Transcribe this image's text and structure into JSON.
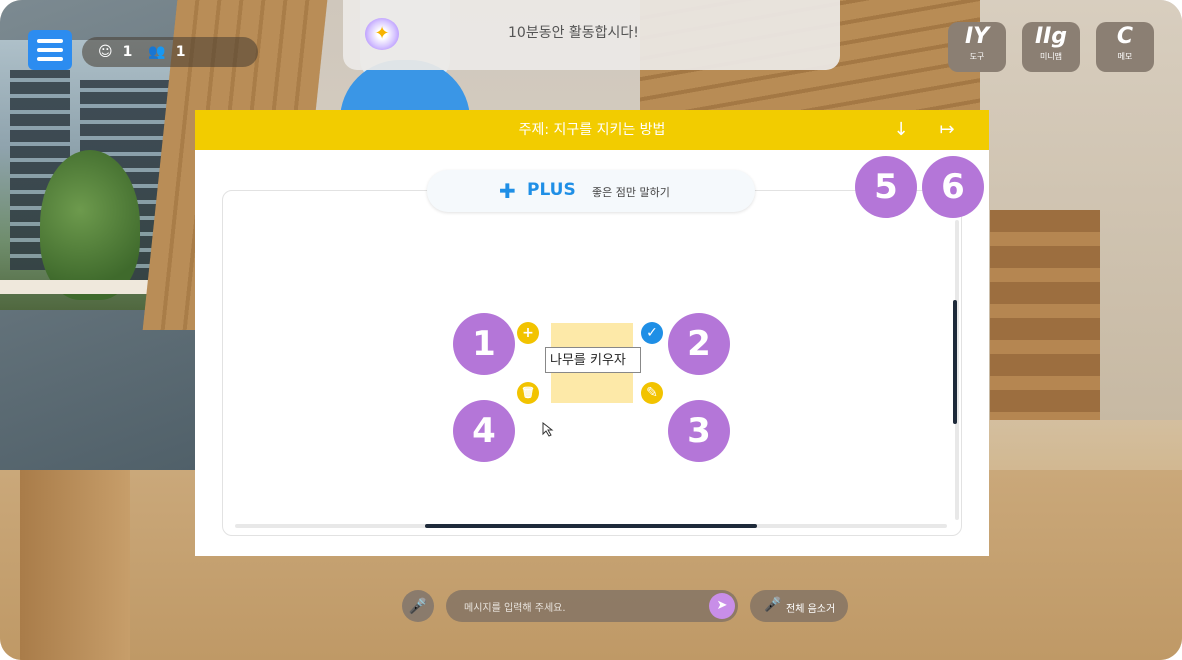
{
  "hud": {
    "user_count": "1",
    "group_count": "1",
    "banner_text": "10분동안 활동합시다!",
    "tools": [
      {
        "label": "도구",
        "glyph": "IY"
      },
      {
        "label": "미니맵",
        "glyph": "IIg"
      },
      {
        "label": "메모",
        "glyph": "C"
      }
    ]
  },
  "board": {
    "title": "주제: 지구를 지키는 방법",
    "download_icon": "↓",
    "exit_icon": "↦",
    "plus": {
      "title": "PLUS",
      "subtitle": "좋은 점만 말하기",
      "icon": "✚"
    },
    "sticky": {
      "value": "나무를 키우자"
    },
    "note_controls": {
      "add": "+",
      "confirm": "✓",
      "delete": "🗑",
      "edit": "✎"
    },
    "markers": [
      "1",
      "2",
      "3",
      "4",
      "5",
      "6"
    ]
  },
  "chat": {
    "placeholder": "메시지를 입력해 주세요.",
    "send_icon": "➤",
    "mic_icon": "🎤",
    "mute_all_label": "전체 음소거"
  },
  "colors": {
    "header": "#f2cc00",
    "accent_blue": "#1f8fe6",
    "marker_purple": "#b476d8",
    "note_yellow": "#fde9a8"
  }
}
